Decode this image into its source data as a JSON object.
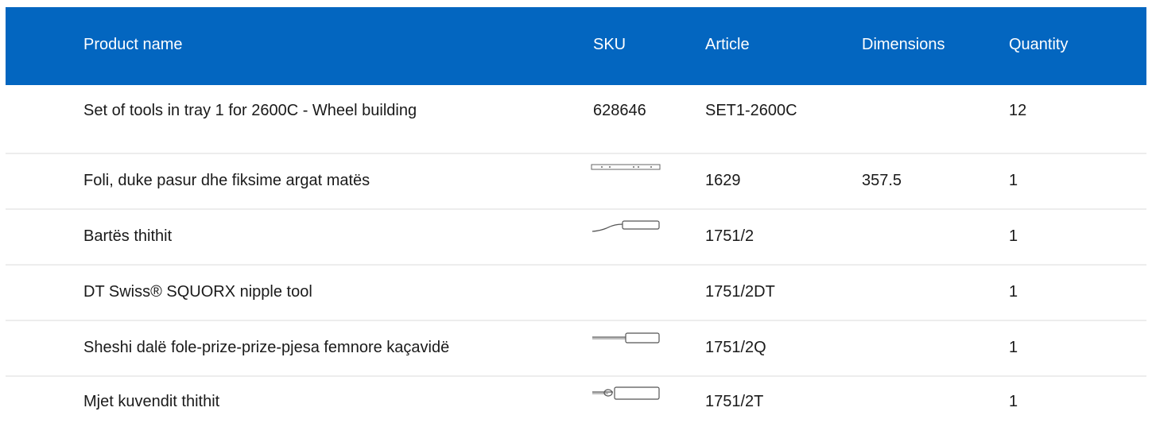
{
  "headers": {
    "name": "Product name",
    "sku": "SKU",
    "article": "Article",
    "dimensions": "Dimensions",
    "quantity": "Quantity"
  },
  "rows": [
    {
      "name": "Set of tools in tray 1 for 2600C - Wheel building",
      "sku": "628646",
      "article": "SET1-2600C",
      "dimensions": "",
      "quantity": "12",
      "thumb": ""
    },
    {
      "name": "Foli, duke pasur dhe fiksime argat matës",
      "sku": "",
      "article": "1629",
      "dimensions": "357.5",
      "quantity": "1",
      "thumb": "ruler-tool-icon"
    },
    {
      "name": "Bartës thithit",
      "sku": "",
      "article": "1751/2",
      "dimensions": "",
      "quantity": "1",
      "thumb": "bent-nipple-holder-icon"
    },
    {
      "name": "DT Swiss® SQUORX nipple tool",
      "sku": "",
      "article": "1751/2DT",
      "dimensions": "",
      "quantity": "1",
      "thumb": ""
    },
    {
      "name": "Sheshi dalë fole-prize-prize-pjesa femnore kaçavidë",
      "sku": "",
      "article": "1751/2Q",
      "dimensions": "",
      "quantity": "1",
      "thumb": "screwdriver-icon"
    },
    {
      "name": "Mjet kuvendit thithit",
      "sku": "",
      "article": "1751/2T",
      "dimensions": "",
      "quantity": "1",
      "thumb": "nipple-assembly-tool-icon"
    }
  ],
  "colors": {
    "header_bg": "#0366c0",
    "header_text": "#ffffff",
    "row_border": "#ededed"
  }
}
